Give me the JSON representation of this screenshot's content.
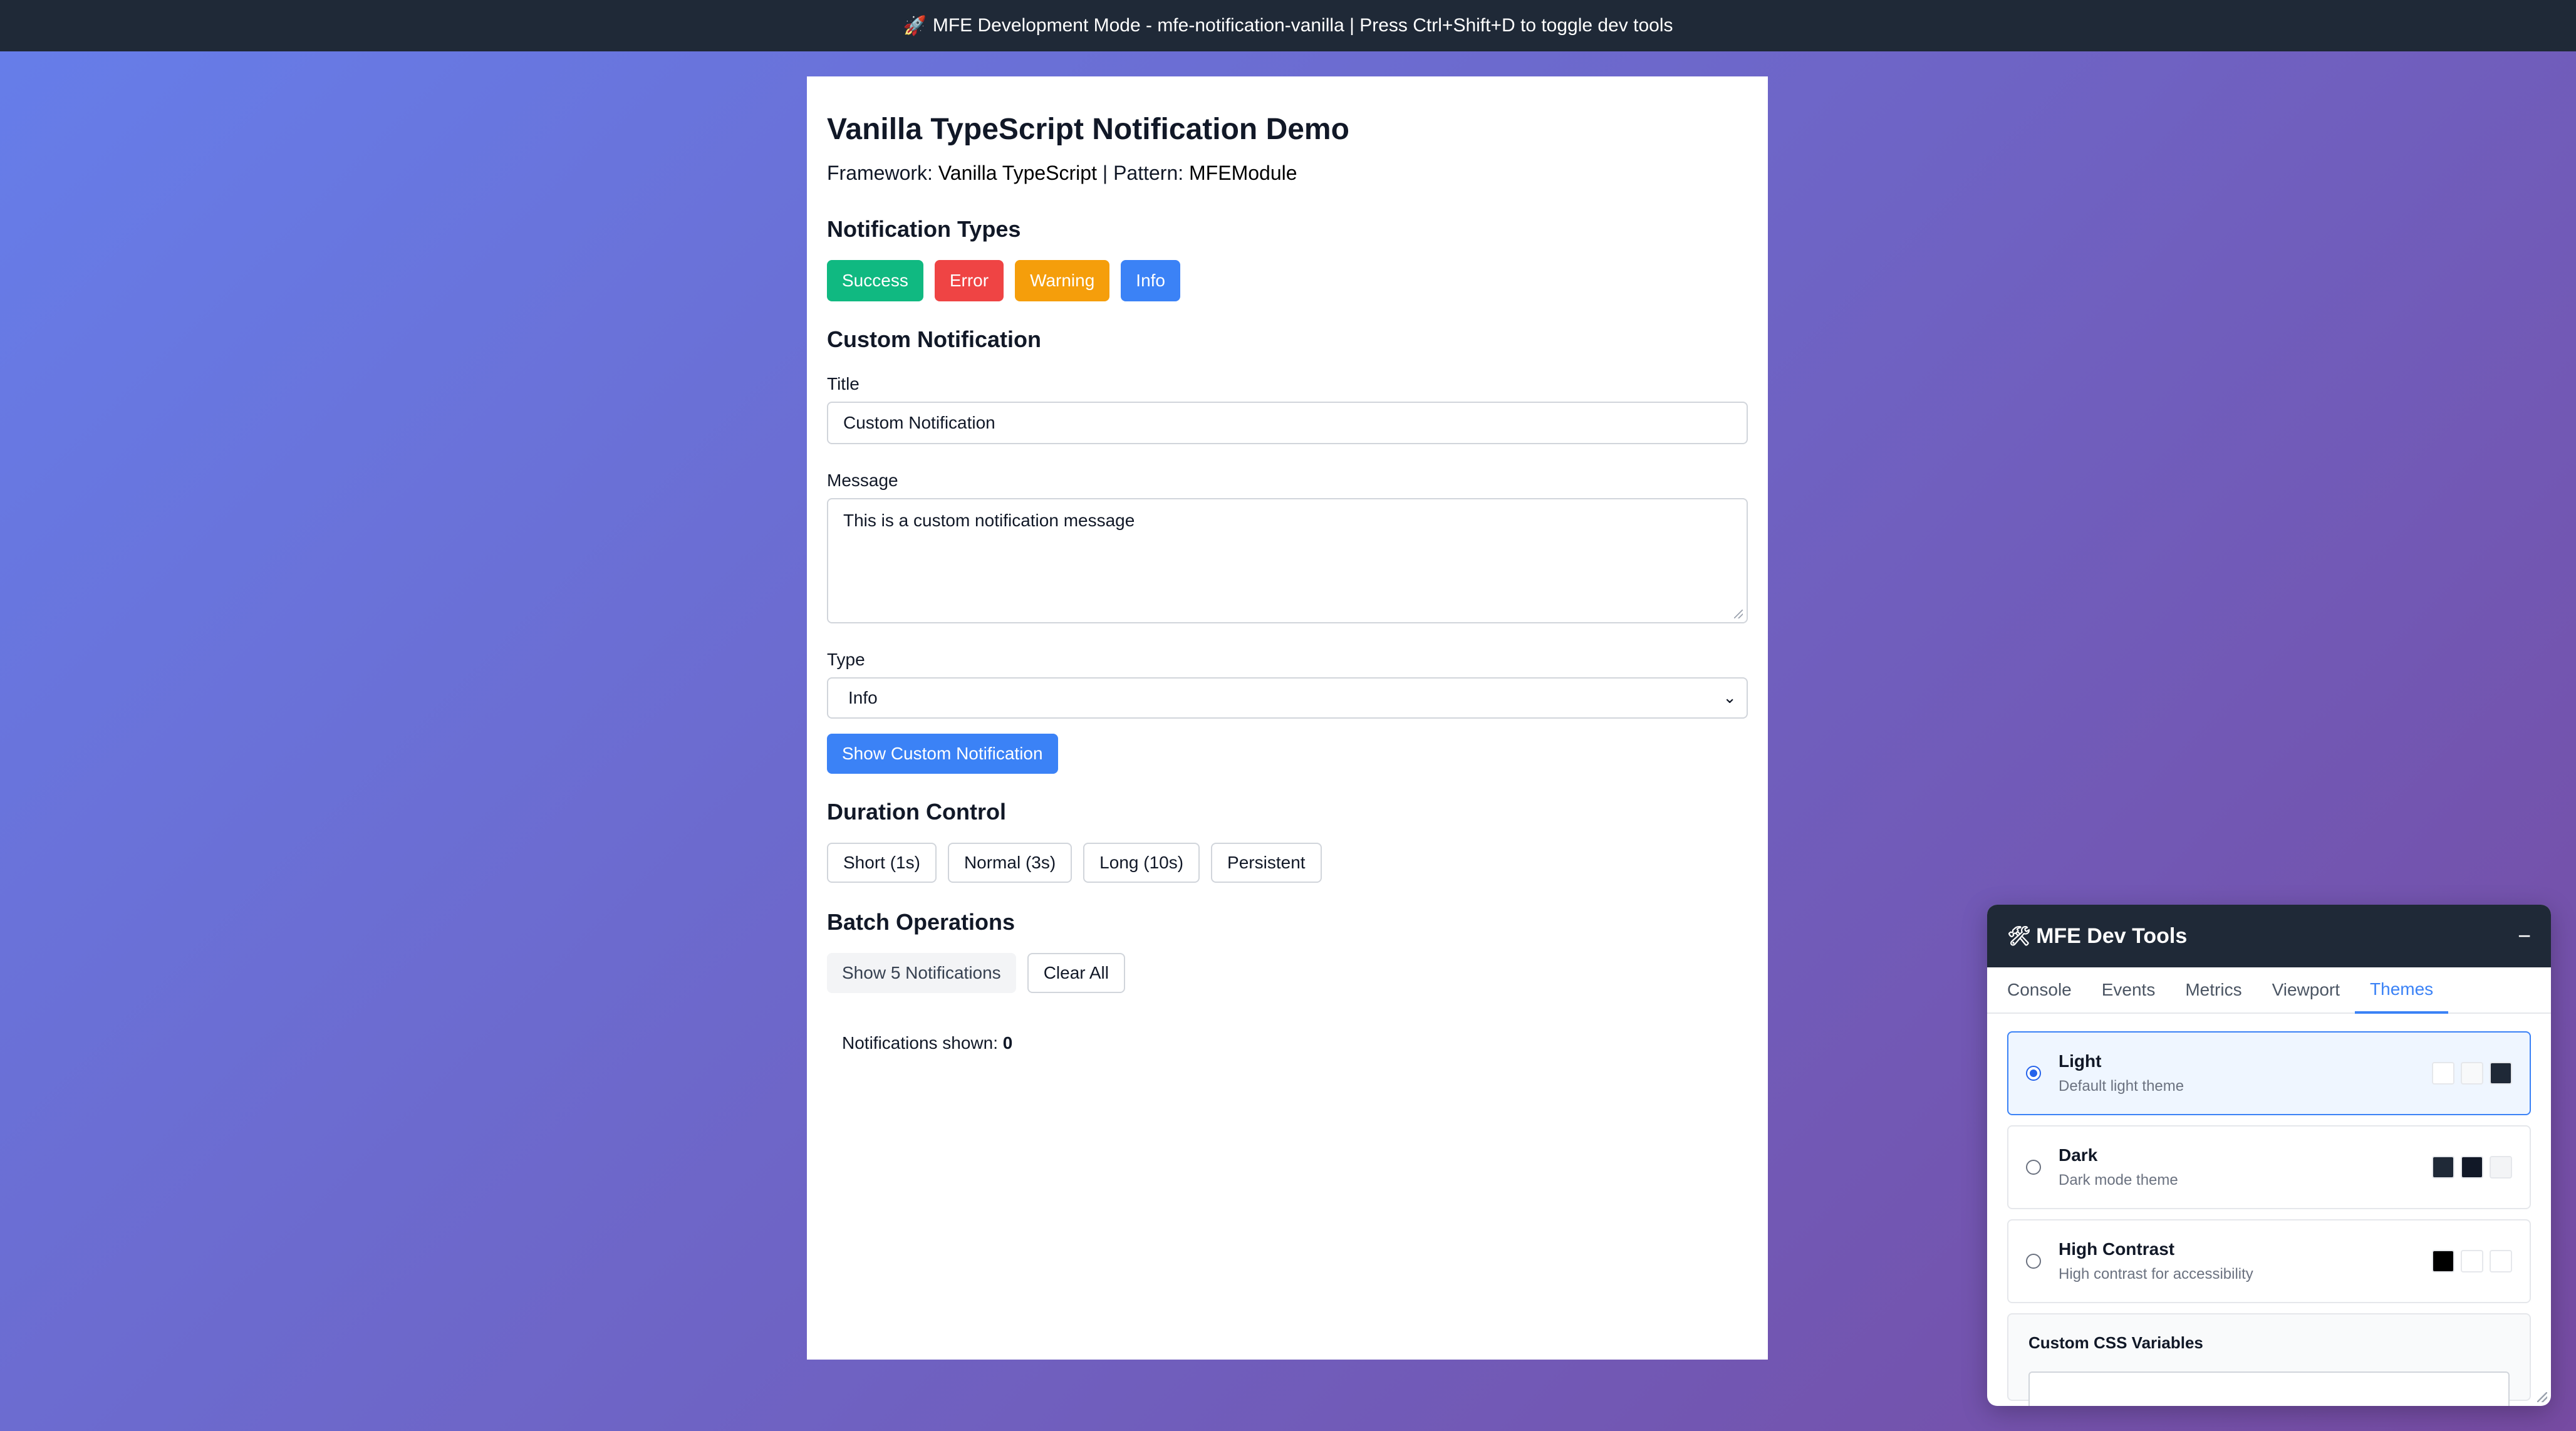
{
  "banner": {
    "icon": "rocket-icon",
    "text": "MFE Development Mode - mfe-notification-vanilla | Press Ctrl+Shift+D to toggle dev tools"
  },
  "demo": {
    "title": "Vanilla TypeScript Notification Demo",
    "framework_label": "Framework:",
    "framework_value": "Vanilla TypeScript",
    "separator": "|",
    "pattern_label": "Pattern:",
    "pattern_value": "MFEModule",
    "types_section": {
      "title": "Notification Types",
      "buttons": {
        "success": "Success",
        "error": "Error",
        "warning": "Warning",
        "info": "Info"
      }
    },
    "custom_section": {
      "title": "Custom Notification",
      "title_label": "Title",
      "title_value": "Custom Notification",
      "message_label": "Message",
      "message_value": "This is a custom notification message",
      "type_label": "Type",
      "type_value": "Info",
      "show_button": "Show Custom Notification"
    },
    "duration_section": {
      "title": "Duration Control",
      "buttons": {
        "short": "Short (1s)",
        "normal": "Normal (3s)",
        "long": "Long (10s)",
        "persistent": "Persistent"
      }
    },
    "batch_section": {
      "title": "Batch Operations",
      "show_five": "Show 5 Notifications",
      "clear_all": "Clear All"
    },
    "counter": {
      "label": "Notifications shown:",
      "value": "0"
    }
  },
  "devtools": {
    "icon": "wrench-icon",
    "title": "MFE Dev Tools",
    "minimize": "−",
    "tabs": {
      "console": "Console",
      "events": "Events",
      "metrics": "Metrics",
      "viewport": "Viewport",
      "themes": "Themes"
    },
    "active_tab": "Themes",
    "themes": [
      {
        "name": "Light",
        "description": "Default light theme",
        "selected": true,
        "swatches": [
          "#ffffff",
          "#f8f9fa",
          "#1f2937"
        ]
      },
      {
        "name": "Dark",
        "description": "Dark mode theme",
        "selected": false,
        "swatches": [
          "#1f2937",
          "#111827",
          "#f3f4f6"
        ]
      },
      {
        "name": "High Contrast",
        "description": "High contrast for accessibility",
        "selected": false,
        "swatches": [
          "#000000",
          "#ffffff",
          "#ffffff"
        ]
      }
    ],
    "css_vars_title": "Custom CSS Variables"
  },
  "colors": {
    "background_start": "#667eea",
    "background_end": "#764ba2",
    "success": "#10b981",
    "error": "#ef4444",
    "warning": "#f59e0b",
    "info": "#3b82f6",
    "dark_header": "#1f2937"
  }
}
